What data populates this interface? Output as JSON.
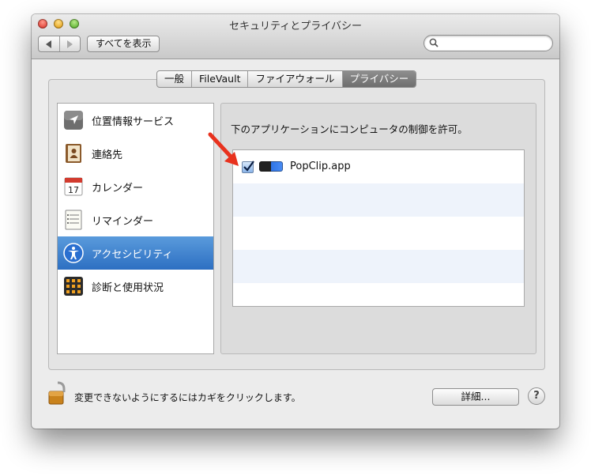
{
  "window": {
    "title": "セキュリティとプライバシー"
  },
  "toolbar": {
    "back_icon": "chevron-left-icon",
    "forward_icon": "chevron-right-icon",
    "show_all_label": "すべてを表示",
    "search_placeholder": ""
  },
  "tabs": [
    {
      "label": "一般",
      "selected": false
    },
    {
      "label": "FileVault",
      "selected": false
    },
    {
      "label": "ファイアウォール",
      "selected": false
    },
    {
      "label": "プライバシー",
      "selected": true
    }
  ],
  "sidebar": {
    "items": [
      {
        "label": "位置情報サービス",
        "icon": "location-arrow-icon",
        "selected": false
      },
      {
        "label": "連絡先",
        "icon": "contacts-book-icon",
        "selected": false
      },
      {
        "label": "カレンダー",
        "icon": "calendar-icon",
        "selected": false,
        "icon_text": "17"
      },
      {
        "label": "リマインダー",
        "icon": "reminders-list-icon",
        "selected": false
      },
      {
        "label": "アクセシビリティ",
        "icon": "accessibility-icon",
        "selected": true
      },
      {
        "label": "診断と使用状況",
        "icon": "diagnostics-icon",
        "selected": false
      }
    ]
  },
  "panel": {
    "instruction": "下のアプリケーションにコンピュータの制御を許可。",
    "apps": [
      {
        "name": "PopClip.app",
        "checked": true,
        "icon": "popclip-app-icon"
      }
    ]
  },
  "footer": {
    "lock_text": "変更できないようにするにはカギをクリックします。",
    "detail_label": "詳細...",
    "help_label": "?"
  },
  "colors": {
    "selection": "#2d6fc2",
    "arrow": "#e8321e",
    "alt_row": "#eef3fb"
  }
}
